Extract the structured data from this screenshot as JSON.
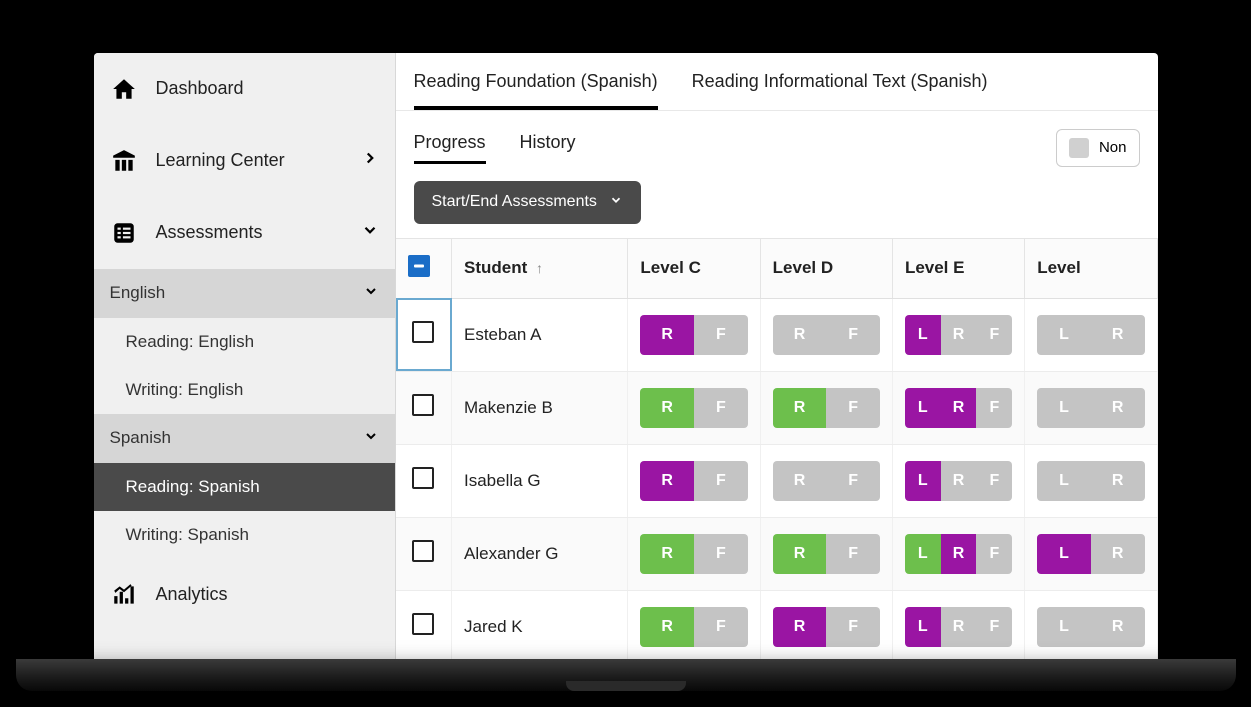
{
  "colors": {
    "green": "#6dbf4c",
    "purple": "#9a15a3",
    "gray": "#c4c4c4"
  },
  "sidebar": {
    "dashboard": "Dashboard",
    "learning_center": "Learning Center",
    "assessments": "Assessments",
    "english": "English",
    "reading_english": "Reading: English",
    "writing_english": "Writing: English",
    "spanish": "Spanish",
    "reading_spanish": "Reading: Spanish",
    "writing_spanish": "Writing: Spanish",
    "analytics": "Analytics"
  },
  "tabs": {
    "reading_foundation": "Reading Foundation (Spanish)",
    "reading_informational": "Reading Informational Text (Spanish)"
  },
  "subtabs": {
    "progress": "Progress",
    "history": "History"
  },
  "filter_label": "Non",
  "action_label": "Start/End Assessments",
  "table": {
    "cols": {
      "student": "Student",
      "level_c": "Level C",
      "level_d": "Level D",
      "level_e": "Level E",
      "level_f": "Level"
    },
    "rows": [
      {
        "name": "Esteban A",
        "cells": [
          [
            {
              "l": "R",
              "c": "purple"
            },
            {
              "l": "F",
              "c": "gray"
            }
          ],
          [
            {
              "l": "R",
              "c": "gray"
            },
            {
              "l": "F",
              "c": "gray"
            }
          ],
          [
            {
              "l": "L",
              "c": "purple"
            },
            {
              "l": "R",
              "c": "gray"
            },
            {
              "l": "F",
              "c": "gray"
            }
          ],
          [
            {
              "l": "L",
              "c": "gray"
            },
            {
              "l": "R",
              "c": "gray"
            }
          ]
        ]
      },
      {
        "name": "Makenzie B",
        "cells": [
          [
            {
              "l": "R",
              "c": "green"
            },
            {
              "l": "F",
              "c": "gray"
            }
          ],
          [
            {
              "l": "R",
              "c": "green"
            },
            {
              "l": "F",
              "c": "gray"
            }
          ],
          [
            {
              "l": "L",
              "c": "purple"
            },
            {
              "l": "R",
              "c": "purple"
            },
            {
              "l": "F",
              "c": "gray"
            }
          ],
          [
            {
              "l": "L",
              "c": "gray"
            },
            {
              "l": "R",
              "c": "gray"
            }
          ]
        ]
      },
      {
        "name": "Isabella G",
        "cells": [
          [
            {
              "l": "R",
              "c": "purple"
            },
            {
              "l": "F",
              "c": "gray"
            }
          ],
          [
            {
              "l": "R",
              "c": "gray"
            },
            {
              "l": "F",
              "c": "gray"
            }
          ],
          [
            {
              "l": "L",
              "c": "purple"
            },
            {
              "l": "R",
              "c": "gray"
            },
            {
              "l": "F",
              "c": "gray"
            }
          ],
          [
            {
              "l": "L",
              "c": "gray"
            },
            {
              "l": "R",
              "c": "gray"
            }
          ]
        ]
      },
      {
        "name": "Alexander G",
        "cells": [
          [
            {
              "l": "R",
              "c": "green"
            },
            {
              "l": "F",
              "c": "gray"
            }
          ],
          [
            {
              "l": "R",
              "c": "green"
            },
            {
              "l": "F",
              "c": "gray"
            }
          ],
          [
            {
              "l": "L",
              "c": "green"
            },
            {
              "l": "R",
              "c": "purple"
            },
            {
              "l": "F",
              "c": "gray"
            }
          ],
          [
            {
              "l": "L",
              "c": "purple"
            },
            {
              "l": "R",
              "c": "gray"
            }
          ]
        ]
      },
      {
        "name": "Jared K",
        "cells": [
          [
            {
              "l": "R",
              "c": "green"
            },
            {
              "l": "F",
              "c": "gray"
            }
          ],
          [
            {
              "l": "R",
              "c": "purple"
            },
            {
              "l": "F",
              "c": "gray"
            }
          ],
          [
            {
              "l": "L",
              "c": "purple"
            },
            {
              "l": "R",
              "c": "gray"
            },
            {
              "l": "F",
              "c": "gray"
            }
          ],
          [
            {
              "l": "L",
              "c": "gray"
            },
            {
              "l": "R",
              "c": "gray"
            }
          ]
        ]
      }
    ]
  }
}
